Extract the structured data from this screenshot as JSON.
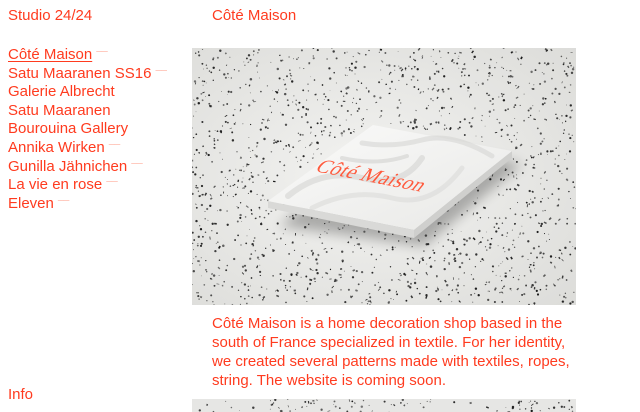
{
  "header": {
    "site_title": "Studio 24/24",
    "page_title": "Côté Maison"
  },
  "nav": {
    "items": [
      {
        "label": "Côté Maison",
        "active": true,
        "has_dash": true
      },
      {
        "label": "Satu Maaranen SS16",
        "active": false,
        "has_dash": true
      },
      {
        "label": "Galerie Albrecht",
        "active": false,
        "has_dash": false
      },
      {
        "label": "Satu Maaranen",
        "active": false,
        "has_dash": false
      },
      {
        "label": "Bourouina Gallery",
        "active": false,
        "has_dash": false
      },
      {
        "label": "Annika Wirken",
        "active": false,
        "has_dash": true
      },
      {
        "label": "Gunilla Jähnichen",
        "active": false,
        "has_dash": true
      },
      {
        "label": "La vie en rose",
        "active": false,
        "has_dash": true
      },
      {
        "label": "Eleven",
        "active": false,
        "has_dash": true
      }
    ],
    "dash_glyph": "——"
  },
  "footer_nav": {
    "info_label": "Info"
  },
  "project": {
    "card_text": "Côté Maison",
    "description": "Côté Maison is a home decoration shop based in the south of France specialized in textile. For her identity, we created several patterns made with textiles, ropes, string. The website is coming soon."
  },
  "colors": {
    "accent": "#ff3b1f",
    "background": "#ffffff",
    "speckle": "#1a1a1a",
    "surface": "#e9e9e7",
    "card": "#f4f4f2"
  }
}
